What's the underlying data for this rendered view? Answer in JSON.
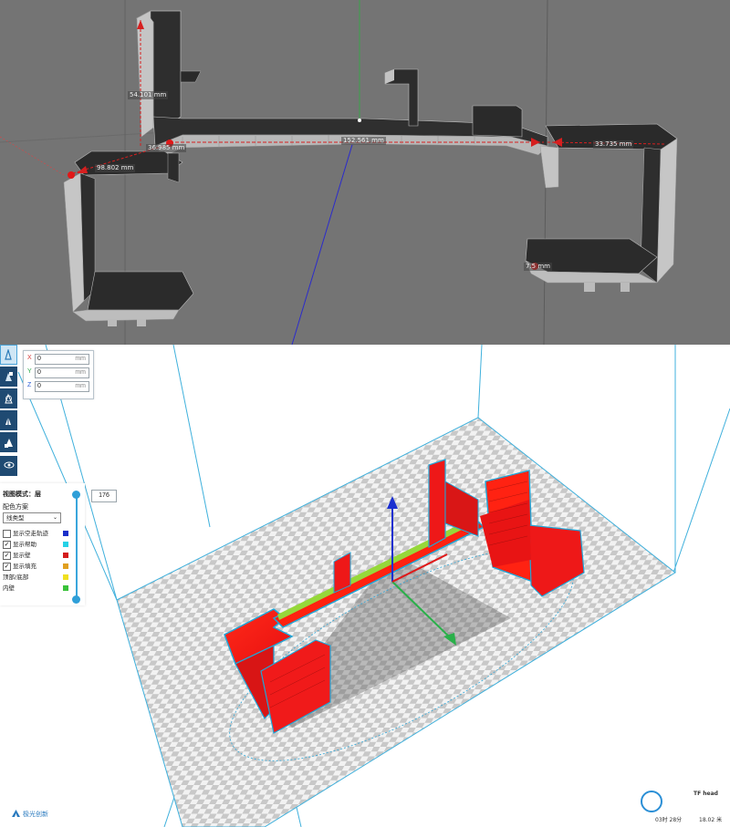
{
  "cad_view": {
    "dimensions": [
      {
        "name": "height",
        "label": "54.101 mm"
      },
      {
        "name": "left-arm",
        "label": "98.802 mm"
      },
      {
        "name": "left-offset",
        "label": "36.985 mm"
      },
      {
        "name": "span",
        "label": "152.561 mm"
      },
      {
        "name": "right-arm",
        "label": "33.735 mm"
      },
      {
        "name": "right-foot",
        "label": "7.5 mm"
      }
    ],
    "colors": {
      "background": "#747474",
      "part_dark": "#2d2d2d",
      "part_light": "#c8c8c8",
      "dimension": "#d61f1f"
    }
  },
  "slicer": {
    "toolbar": {
      "tools": [
        {
          "icon": "move-icon",
          "active": true
        },
        {
          "icon": "scale-icon",
          "active": false
        },
        {
          "icon": "rotate-icon",
          "active": false
        },
        {
          "icon": "mirror-icon",
          "active": false
        },
        {
          "icon": "support-icon",
          "active": false
        },
        {
          "icon": "view-eye-icon",
          "active": false
        }
      ]
    },
    "position_panel": {
      "x": {
        "axis": "X",
        "value": "0",
        "unit": "mm",
        "color": "#d63a3a"
      },
      "y": {
        "axis": "Y",
        "value": "0",
        "unit": "mm",
        "color": "#2aa84a"
      },
      "z": {
        "axis": "Z",
        "value": "0",
        "unit": "mm",
        "color": "#2a5bd6"
      }
    },
    "view_panel": {
      "title": "视图模式：层",
      "scheme_label": "配色方案",
      "scheme_value": "线类型",
      "options": [
        {
          "label": "显示空走轨迹",
          "checked": false,
          "color": "#1a2fc9"
        },
        {
          "label": "显示帮助",
          "checked": true,
          "color": "#25d2e6"
        },
        {
          "label": "显示壁",
          "checked": true,
          "color": "#d41c1c"
        },
        {
          "label": "显示填充",
          "checked": true,
          "color": "#e0a020"
        },
        {
          "label": "顶部/底部",
          "checked": null,
          "color": "#f0e020"
        },
        {
          "label": "内壁",
          "checked": null,
          "color": "#3ac23a"
        }
      ]
    },
    "layer": {
      "current": "176"
    },
    "brand": {
      "name": "极光创新"
    },
    "status": {
      "name": "TF head",
      "time": "03时 28分",
      "material": "18.02 米"
    },
    "colors": {
      "accent": "#2f9fd8",
      "model_red": "#ff1e1e",
      "model_outline": "#1fa6d8",
      "layer_green": "#7fd63a"
    }
  }
}
